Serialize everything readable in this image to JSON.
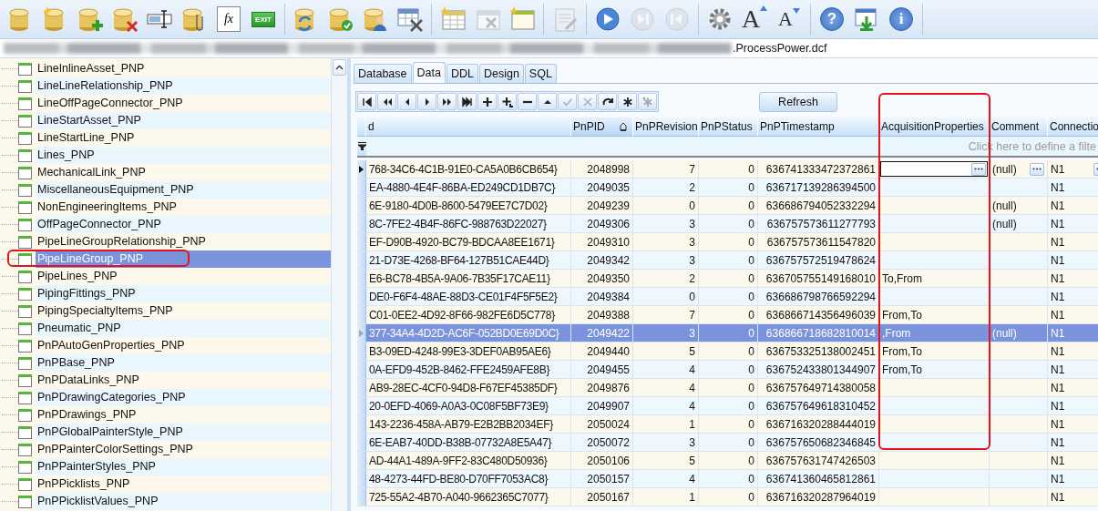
{
  "toolbar": {
    "groups": [
      [
        {
          "kind": "db"
        },
        {
          "kind": "db-new"
        },
        {
          "kind": "db-add"
        },
        {
          "kind": "db-delete"
        },
        {
          "kind": "field"
        },
        {
          "kind": "db-clip"
        },
        {
          "kind": "fx",
          "label": "fx"
        },
        {
          "kind": "exit",
          "label": "EXIT"
        }
      ],
      [
        {
          "kind": "db-refresh"
        },
        {
          "kind": "db-check"
        },
        {
          "kind": "db-user"
        },
        {
          "kind": "table-tools"
        }
      ],
      [
        {
          "kind": "table-new"
        },
        {
          "kind": "table-delete",
          "disabled": true
        },
        {
          "kind": "window-new"
        }
      ],
      [
        {
          "kind": "doc-edit",
          "disabled": true
        }
      ],
      [
        {
          "kind": "play"
        },
        {
          "kind": "next",
          "disabled": true
        },
        {
          "kind": "prev",
          "disabled": true
        }
      ],
      [
        {
          "kind": "gear"
        },
        {
          "kind": "font-up",
          "label": "A"
        },
        {
          "kind": "font-down",
          "label": "A"
        }
      ],
      [
        {
          "kind": "help",
          "label": "?"
        },
        {
          "kind": "window-download"
        },
        {
          "kind": "info",
          "label": "i"
        }
      ]
    ]
  },
  "path_bar": {
    "file": ".ProcessPower.dcf"
  },
  "tree": {
    "items": [
      {
        "label": "LineInlineAsset_PNP",
        "selected": false
      },
      {
        "label": "LineLineRelationship_PNP",
        "selected": false
      },
      {
        "label": "LineOffPageConnector_PNP",
        "selected": false
      },
      {
        "label": "LineStartAsset_PNP",
        "selected": false
      },
      {
        "label": "LineStartLine_PNP",
        "selected": false
      },
      {
        "label": "Lines_PNP",
        "selected": false
      },
      {
        "label": "MechanicalLink_PNP",
        "selected": false
      },
      {
        "label": "MiscellaneousEquipment_PNP",
        "selected": false
      },
      {
        "label": "NonEngineeringItems_PNP",
        "selected": false
      },
      {
        "label": "OffPageConnector_PNP",
        "selected": false
      },
      {
        "label": "PipeLineGroupRelationship_PNP",
        "selected": false
      },
      {
        "label": "PipeLineGroup_PNP",
        "selected": true
      },
      {
        "label": "PipeLines_PNP",
        "selected": false
      },
      {
        "label": "PipingFittings_PNP",
        "selected": false
      },
      {
        "label": "PipingSpecialtyItems_PNP",
        "selected": false
      },
      {
        "label": "Pneumatic_PNP",
        "selected": false
      },
      {
        "label": "PnPAutoGenProperties_PNP",
        "selected": false
      },
      {
        "label": "PnPBase_PNP",
        "selected": false
      },
      {
        "label": "PnPDataLinks_PNP",
        "selected": false
      },
      {
        "label": "PnPDrawingCategories_PNP",
        "selected": false
      },
      {
        "label": "PnPDrawings_PNP",
        "selected": false
      },
      {
        "label": "PnPGlobalPainterStyle_PNP",
        "selected": false
      },
      {
        "label": "PnPPainterColorSettings_PNP",
        "selected": false
      },
      {
        "label": "PnPPainterStyles_PNP",
        "selected": false
      },
      {
        "label": "PnPPicklists_PNP",
        "selected": false
      },
      {
        "label": "PnPPicklistValues_PNP",
        "selected": false
      }
    ]
  },
  "tabs": [
    {
      "label": "Database",
      "selected": false
    },
    {
      "label": "Data",
      "selected": true
    },
    {
      "label": "DDL",
      "selected": false
    },
    {
      "label": "Design",
      "selected": false
    },
    {
      "label": "SQL",
      "selected": false
    }
  ],
  "navigator": [
    {
      "kind": "first",
      "disabled": false
    },
    {
      "kind": "prior-page",
      "disabled": false
    },
    {
      "kind": "prior",
      "disabled": false
    },
    {
      "kind": "next",
      "disabled": false
    },
    {
      "kind": "next-page",
      "disabled": false
    },
    {
      "kind": "last",
      "disabled": false
    },
    {
      "kind": "insert",
      "disabled": false
    },
    {
      "kind": "append",
      "disabled": false
    },
    {
      "kind": "delete",
      "disabled": false
    },
    {
      "kind": "edit",
      "disabled": false
    },
    {
      "kind": "post",
      "disabled": true
    },
    {
      "kind": "cancel",
      "disabled": true
    },
    {
      "kind": "refresh",
      "disabled": false
    },
    {
      "kind": "bookmark",
      "disabled": false
    },
    {
      "kind": "goto-bookmark",
      "disabled": true
    }
  ],
  "refresh_button": "Refresh",
  "grid": {
    "columns": [
      {
        "label": "d",
        "sorted": false
      },
      {
        "label": "PnPID",
        "sorted": true
      },
      {
        "label": "PnPRevision",
        "sorted": false
      },
      {
        "label": "PnPStatus",
        "sorted": false
      },
      {
        "label": "PnPTimestamp",
        "sorted": false
      },
      {
        "label": "AcquisitionProperties",
        "sorted": false
      },
      {
        "label": "Comment",
        "sorted": false
      },
      {
        "label": "Connectio",
        "sorted": false
      }
    ],
    "filter_hint": "Click here to define a filte",
    "rows": [
      {
        "id": "768-34C6-4C1B-91E0-CA5A0B6CB654}",
        "pnpid": "2048998",
        "revision": "7",
        "status": "0",
        "timestamp": "636741333472372861",
        "comment": "(null)",
        "connection": "N1",
        "current": true,
        "selected": false,
        "editing": true
      },
      {
        "id": "EA-4880-4E4F-86BA-ED249CD1DB7C}",
        "pnpid": "2049035",
        "revision": "2",
        "status": "0",
        "timestamp": "636717139286394500",
        "connection": "N1",
        "current": false,
        "selected": false,
        "editing": false
      },
      {
        "id": "6E-9180-4D0B-8600-5479EE7C7D02}",
        "pnpid": "2049239",
        "revision": "0",
        "status": "0",
        "timestamp": "636686794052332294",
        "comment": "(null)",
        "connection": "N1",
        "current": false,
        "selected": false,
        "editing": false
      },
      {
        "id": "8C-7FE2-4B4F-86FC-988763D22027}",
        "pnpid": "2049306",
        "revision": "3",
        "status": "0",
        "timestamp": "636757573611277793",
        "comment": "(null)",
        "connection": "N1",
        "current": false,
        "selected": false,
        "editing": false
      },
      {
        "id": "EF-D90B-4920-BC79-BDCAA8EE1671}",
        "pnpid": "2049310",
        "revision": "3",
        "status": "0",
        "timestamp": "636757573611547820",
        "connection": "N1",
        "current": false,
        "selected": false,
        "editing": false
      },
      {
        "id": "21-D73E-4268-BF64-127B51CAE44D}",
        "pnpid": "2049342",
        "revision": "3",
        "status": "0",
        "timestamp": "636757572519478624",
        "connection": "N1",
        "current": false,
        "selected": false,
        "editing": false
      },
      {
        "id": "E6-BC78-4B5A-9A06-7B35F17CAE11}",
        "pnpid": "2049350",
        "revision": "2",
        "status": "0",
        "timestamp": "636705755149168010",
        "acquisition": "To,From",
        "connection": "N1",
        "current": false,
        "selected": false,
        "editing": false
      },
      {
        "id": "DE0-F6F4-48AE-88D3-CE01F4F5F5E2}",
        "pnpid": "2049384",
        "revision": "0",
        "status": "0",
        "timestamp": "636686798766592294",
        "connection": "N1",
        "current": false,
        "selected": false,
        "editing": false
      },
      {
        "id": "C01-0EE2-4D92-8F66-982FE6D5C778}",
        "pnpid": "2049388",
        "revision": "7",
        "status": "0",
        "timestamp": "636866714356496039",
        "acquisition": "From,To",
        "connection": "N1",
        "current": false,
        "selected": false,
        "editing": false
      },
      {
        "id": "377-34A4-4D2D-AC6F-052BD0E69D0C}",
        "pnpid": "2049422",
        "revision": "3",
        "status": "0",
        "timestamp": "636866718682810014",
        "acquisition": ",From",
        "comment": "(null)",
        "connection": "N1",
        "current": false,
        "selected": true,
        "editing": false
      },
      {
        "id": "B3-09ED-4248-99E3-3DEF0AB95AE6}",
        "pnpid": "2049440",
        "revision": "5",
        "status": "0",
        "timestamp": "636753325138002451",
        "acquisition": "From,To",
        "connection": "N1",
        "current": false,
        "selected": false,
        "editing": false
      },
      {
        "id": "0A-EFD9-452B-8462-FFE2459AFE8B}",
        "pnpid": "2049455",
        "revision": "4",
        "status": "0",
        "timestamp": "636752433801344907",
        "acquisition": "From,To",
        "connection": "N1",
        "current": false,
        "selected": false,
        "editing": false
      },
      {
        "id": "AB9-28EC-4CF0-94D8-F67EF45385DF}",
        "pnpid": "2049876",
        "revision": "4",
        "status": "0",
        "timestamp": "636757649714380058",
        "connection": "N1",
        "current": false,
        "selected": false,
        "editing": false
      },
      {
        "id": "20-0EFD-4069-A0A3-0C08F5BF73E9}",
        "pnpid": "2049907",
        "revision": "4",
        "status": "0",
        "timestamp": "636757649618310452",
        "connection": "N1",
        "current": false,
        "selected": false,
        "editing": false
      },
      {
        "id": "143-2236-458A-AB79-E2B2BB2034EF}",
        "pnpid": "2050024",
        "revision": "1",
        "status": "0",
        "timestamp": "636716320288444019",
        "connection": "N1",
        "current": false,
        "selected": false,
        "editing": false
      },
      {
        "id": "6E-EAB7-40DD-B38B-07732A8E5A47}",
        "pnpid": "2050072",
        "revision": "3",
        "status": "0",
        "timestamp": "636757650682346845",
        "connection": "N1",
        "current": false,
        "selected": false,
        "editing": false
      },
      {
        "id": "AD-44A1-489A-9FF2-83C480D50936}",
        "pnpid": "2050106",
        "revision": "5",
        "status": "0",
        "timestamp": "636757631747426503",
        "connection": "N1",
        "current": false,
        "selected": false,
        "editing": false
      },
      {
        "id": "48-4273-44FD-BE80-D70FF7053AC8}",
        "pnpid": "2050157",
        "revision": "4",
        "status": "0",
        "timestamp": "636741360465812861",
        "connection": "N1",
        "current": false,
        "selected": false,
        "editing": false
      },
      {
        "id": "725-55A2-4B70-A040-9662365C7077}",
        "pnpid": "2050167",
        "revision": "1",
        "status": "0",
        "timestamp": "636716320287964019",
        "connection": "N1",
        "current": false,
        "selected": false,
        "editing": false
      }
    ]
  }
}
